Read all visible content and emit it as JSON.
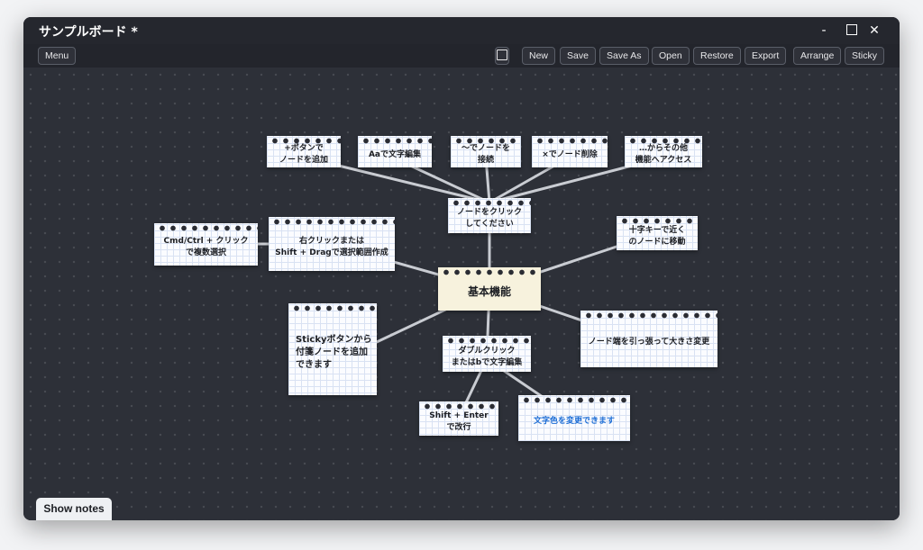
{
  "window": {
    "title": "サンプルボード *",
    "controls": {
      "minimize": "-",
      "close": "✕"
    }
  },
  "toolbar": {
    "menu_label": "Menu",
    "buttons": [
      "New",
      "Save",
      "Save As",
      "Open",
      "Restore",
      "Export",
      "Arrange",
      "Sticky"
    ]
  },
  "nodes": {
    "main": "基本機能",
    "click": "ノードをクリック\nしてください",
    "add": "+ボタンで\nノードを追加",
    "text_edit": "Aaで文字編集",
    "connect": "〜でノードを\n接続",
    "delete": "×でノード削除",
    "more": "…からその他\n機能へアクセス",
    "right_click": "右クリックまたは\nShift + Dragで選択範囲作成",
    "multi_select": "Cmd/Ctrl + クリック\nで複数選択",
    "arrow_keys": "十字キーで近く\nのノードに移動",
    "sticky": "Stickyボタンから\n付箋ノードを追加\nできます",
    "resize": "ノード端を引っ張って大きさ変更",
    "double_click": "ダブルクリック\nまたはbで文字編集",
    "newline": "Shift + Enter\nで改行",
    "color": "文字色を変更できます"
  },
  "colors": {
    "canvas": "#2d3038",
    "node_paper": "#fbfcff",
    "main_node": "#f7f2dd",
    "edge": "#c9ccd2",
    "blue_text": "#1f6fd6"
  },
  "footer": {
    "show_notes_label": "Show notes"
  }
}
